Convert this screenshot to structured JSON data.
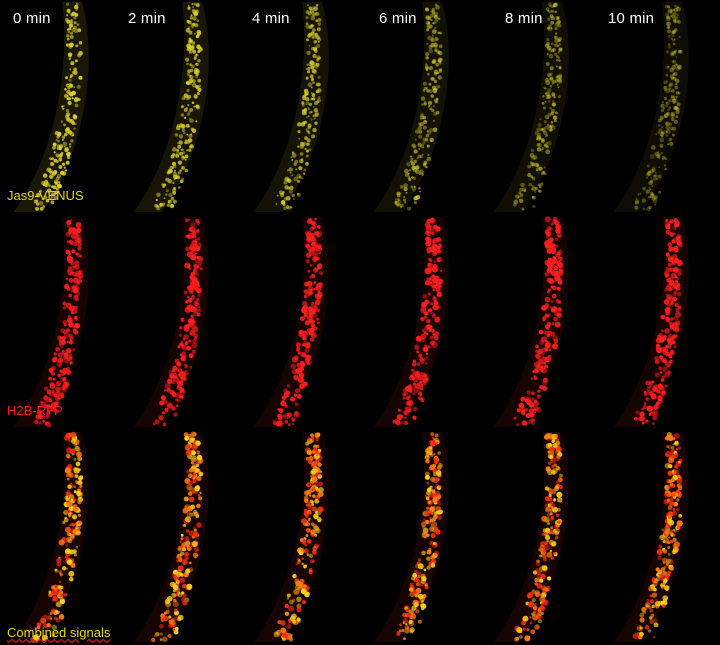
{
  "time_points": [
    "0 min",
    "2 min",
    "4 min",
    "6 min",
    "8 min",
    "10 min"
  ],
  "channels": [
    {
      "label": "Jas9-VENUS",
      "color": "#e7d61a",
      "dot_color": "#d9cf2c"
    },
    {
      "label": "H2B-RFP",
      "color": "#ff1a1a",
      "dot_color": "#ff1f1f"
    },
    {
      "label": "Combined signals",
      "color": "#e9d81c",
      "dot_color": "#ff3a14"
    }
  ],
  "colors": {
    "background": "#000000",
    "time_label": "#ffffff"
  }
}
